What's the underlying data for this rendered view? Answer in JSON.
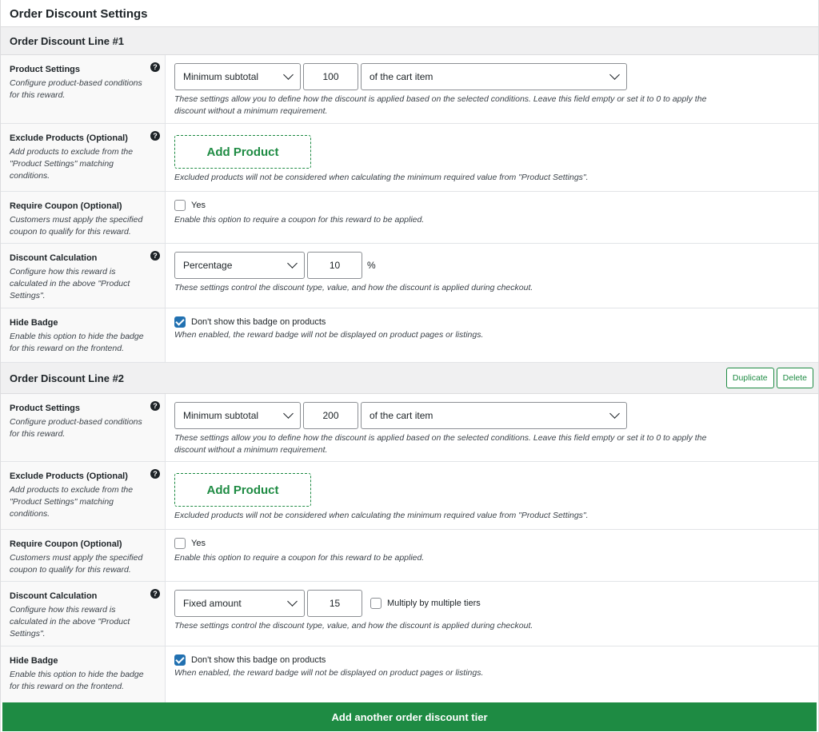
{
  "page": {
    "title": "Order Discount Settings"
  },
  "lines": [
    {
      "title": "Order Discount Line #1",
      "product_settings": {
        "label": "Product Settings",
        "sub": "Configure product-based conditions for this reward.",
        "condition": "Minimum subtotal",
        "value": "100",
        "scope": "of the cart item",
        "desc": "These settings allow you to define how the discount is applied based on the selected conditions. Leave this field empty or set it to 0 to apply the discount without a minimum requirement."
      },
      "exclude": {
        "label": "Exclude Products (Optional)",
        "sub": "Add products to exclude from the \"Product Settings\" matching conditions.",
        "button": "Add Product",
        "desc": "Excluded products will not be considered when calculating the minimum required value from \"Product Settings\"."
      },
      "coupon": {
        "label": "Require Coupon (Optional)",
        "sub": "Customers must apply the specified coupon to qualify for this reward.",
        "checkbox_label": "Yes",
        "checked": false,
        "desc": "Enable this option to require a coupon for this reward to be applied."
      },
      "discount": {
        "label": "Discount Calculation",
        "sub": "Configure how this reward is calculated in the above \"Product Settings\".",
        "type": "Percentage",
        "value": "10",
        "unit": "%",
        "desc": "These settings control the discount type, value, and how the discount is applied during checkout."
      },
      "badge": {
        "label": "Hide Badge",
        "sub": "Enable this option to hide the badge for this reward on the frontend.",
        "checkbox_label": "Don't show this badge on products",
        "checked": true,
        "desc": "When enabled, the reward badge will not be displayed on product pages or listings."
      }
    },
    {
      "title": "Order Discount Line #2",
      "duplicate_label": "Duplicate",
      "delete_label": "Delete",
      "product_settings": {
        "label": "Product Settings",
        "sub": "Configure product-based conditions for this reward.",
        "condition": "Minimum subtotal",
        "value": "200",
        "scope": "of the cart item",
        "desc": "These settings allow you to define how the discount is applied based on the selected conditions. Leave this field empty or set it to 0 to apply the discount without a minimum requirement."
      },
      "exclude": {
        "label": "Exclude Products (Optional)",
        "sub": "Add products to exclude from the \"Product Settings\" matching conditions.",
        "button": "Add Product",
        "desc": "Excluded products will not be considered when calculating the minimum required value from \"Product Settings\"."
      },
      "coupon": {
        "label": "Require Coupon (Optional)",
        "sub": "Customers must apply the specified coupon to qualify for this reward.",
        "checkbox_label": "Yes",
        "checked": false,
        "desc": "Enable this option to require a coupon for this reward to be applied."
      },
      "discount": {
        "label": "Discount Calculation",
        "sub": "Configure how this reward is calculated in the above \"Product Settings\".",
        "type": "Fixed amount",
        "value": "15",
        "multiply_label": "Multiply by multiple tiers",
        "multiply_checked": false,
        "desc": "These settings control the discount type, value, and how the discount is applied during checkout."
      },
      "badge": {
        "label": "Hide Badge",
        "sub": "Enable this option to hide the badge for this reward on the frontend.",
        "checkbox_label": "Don't show this badge on products",
        "checked": true,
        "desc": "When enabled, the reward badge will not be displayed on product pages or listings."
      }
    }
  ],
  "help_glyph": "?",
  "add_tier_label": "Add another order discount tier",
  "colors": {
    "accent_green": "#1e8b43",
    "checkbox_blue": "#2271b1",
    "header_gray": "#f0f0f1"
  }
}
